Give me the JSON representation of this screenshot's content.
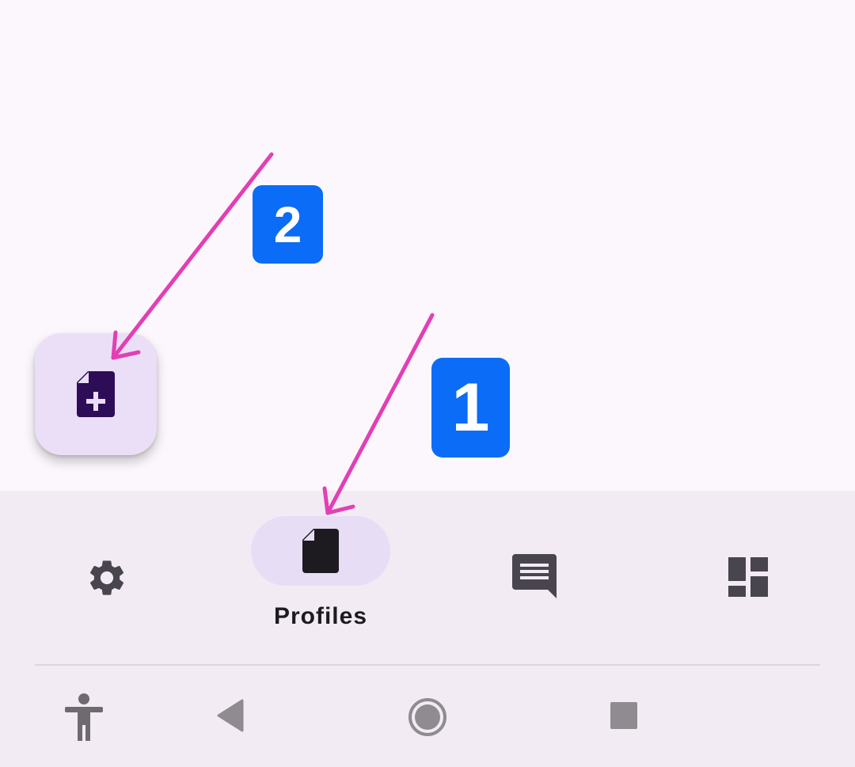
{
  "colors": {
    "background": "#fcf7fc",
    "nav_background": "#f2ebf4",
    "nav_active_indicator": "#e7def5",
    "fab_background": "#eadff7",
    "fab_icon": "#2d0d57",
    "icon_dark": "#49454f",
    "annotation_badge": "#0a6cf7",
    "annotation_arrow": "#e23fb5",
    "system_nav_icon": "#8f8b91"
  },
  "fab": {
    "icon": "note-add-icon"
  },
  "bottom_nav": {
    "items": [
      {
        "id": "settings",
        "icon": "gear-icon",
        "label": ""
      },
      {
        "id": "profiles",
        "icon": "document-icon",
        "label": "Profiles",
        "selected": true
      },
      {
        "id": "messages",
        "icon": "chat-icon",
        "label": ""
      },
      {
        "id": "dashboard",
        "icon": "dashboard-icon",
        "label": ""
      }
    ]
  },
  "system_nav": {
    "buttons": [
      {
        "id": "accessibility",
        "icon": "accessibility-icon"
      },
      {
        "id": "back",
        "icon": "back-triangle-icon"
      },
      {
        "id": "home",
        "icon": "home-circle-icon"
      },
      {
        "id": "recents",
        "icon": "recents-square-icon"
      }
    ]
  },
  "annotations": {
    "badge_1": "1",
    "badge_2": "2"
  }
}
